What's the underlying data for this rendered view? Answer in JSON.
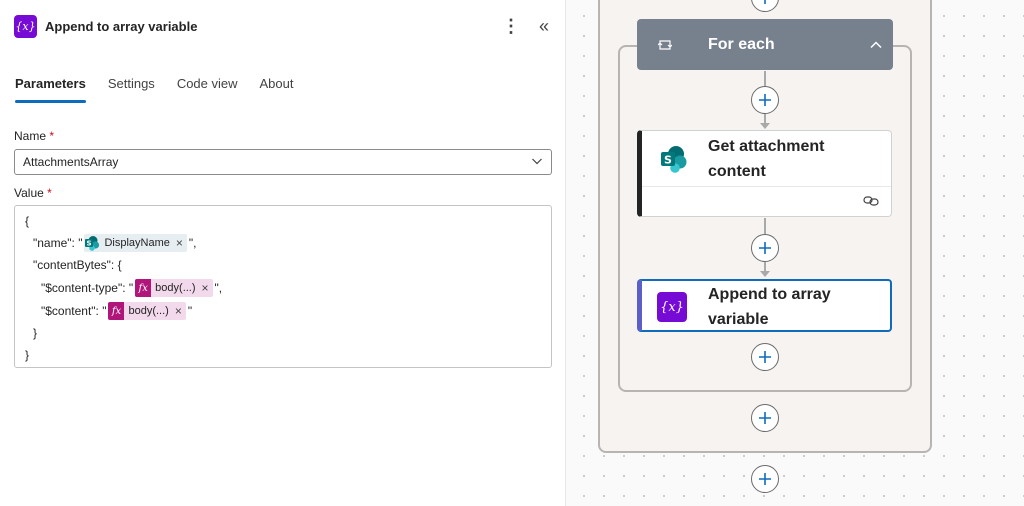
{
  "panel": {
    "title": "Append to array variable",
    "icon_text": "{x}",
    "tabs": [
      {
        "label": "Parameters",
        "active": true
      },
      {
        "label": "Settings",
        "active": false
      },
      {
        "label": "Code view",
        "active": false
      },
      {
        "label": "About",
        "active": false
      }
    ],
    "name_label": "Name",
    "required_mark": "*",
    "name_value": "AttachmentsArray",
    "value_label": "Value",
    "code": {
      "open_brace": "{",
      "name_key": "\"name\": \"",
      "name_token": "DisplayName",
      "name_suffix": "\",",
      "content_bytes_key": "\"contentBytes\": {",
      "content_type_key": "\"$content-type\": \"",
      "content_type_token": "body(...)",
      "content_type_suffix": "\",",
      "content_key": "\"$content\": \"",
      "content_token": "body(...)",
      "content_suffix": "\"",
      "inner_close": "}",
      "outer_close": "}",
      "fx_icon": "fx",
      "token_close": "×"
    }
  },
  "canvas": {
    "foreach_title": "For each",
    "card_get": {
      "title": "Get attachment content",
      "icon": "sharepoint-icon"
    },
    "card_append": {
      "title": "Append to array variable",
      "icon_text": "{x}"
    }
  },
  "colors": {
    "variable_purple": "#770bd6",
    "tab_underline": "#0f6cbd",
    "foreach_header": "#77818e",
    "expression_token": "#b0167a",
    "selected_border": "#0f6cbd"
  }
}
